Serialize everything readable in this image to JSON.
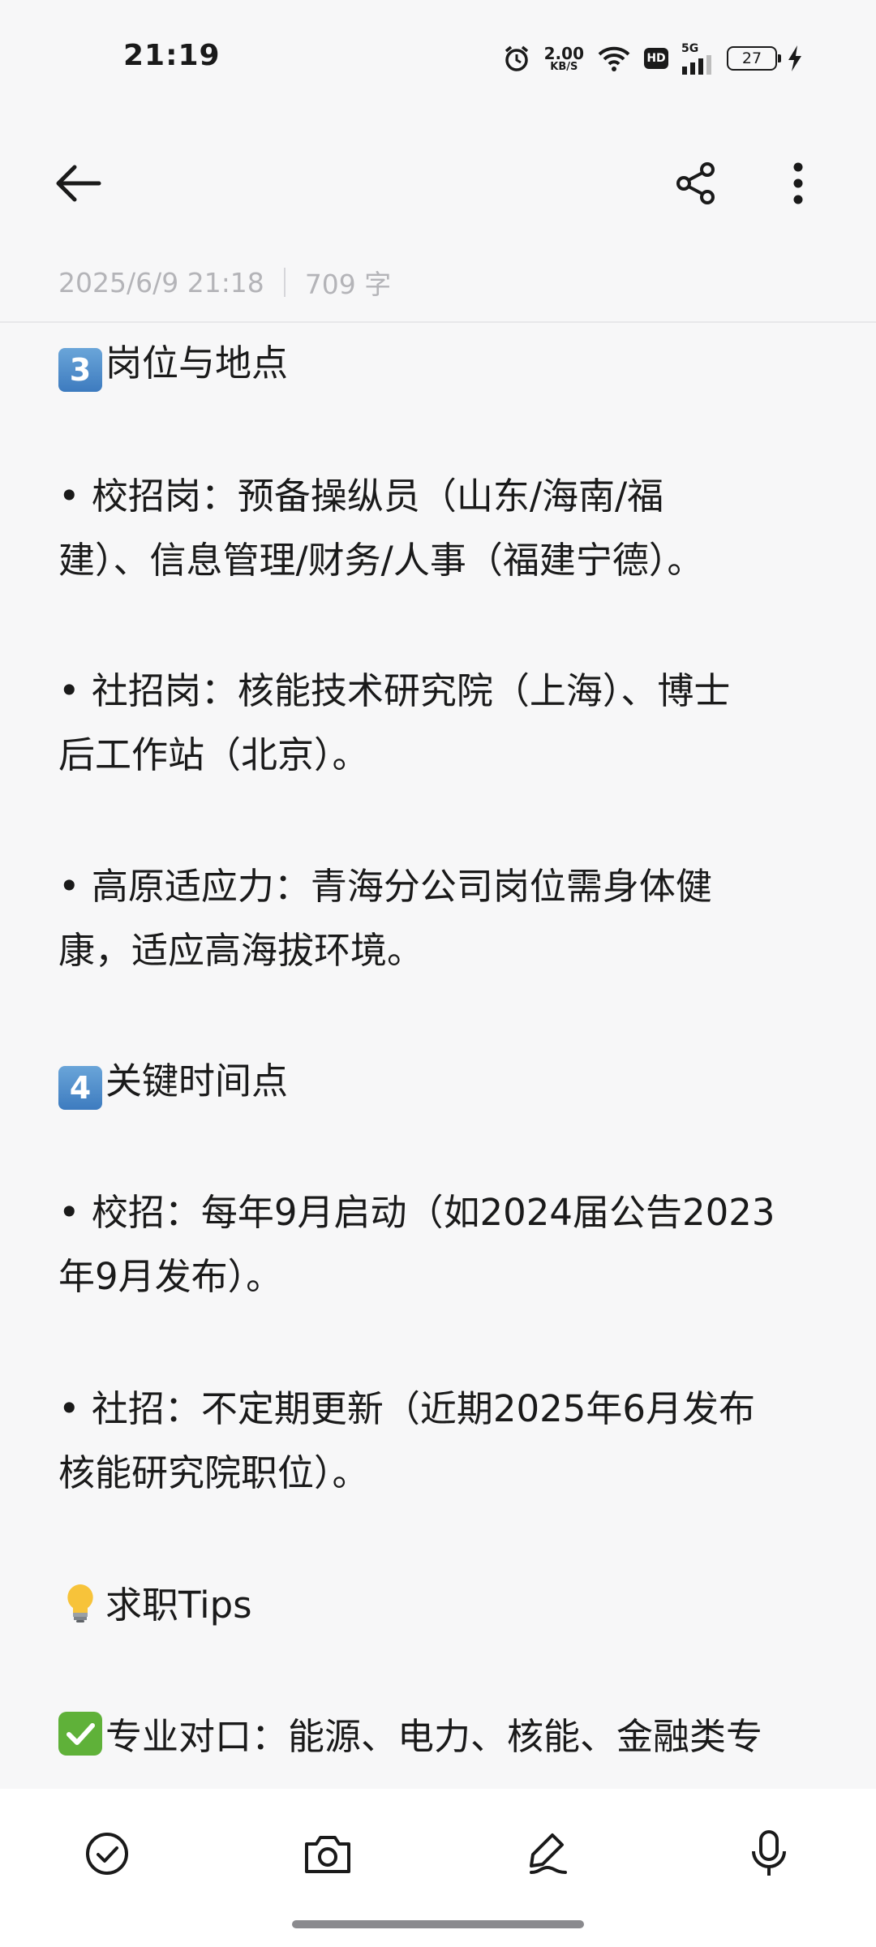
{
  "status_bar": {
    "time": "21:19",
    "net_speed_value": "2.00",
    "net_speed_unit": "KB/S",
    "hd_label": "HD",
    "network_label": "5G",
    "battery_level": "27",
    "icons": [
      "alarm-icon",
      "wifi-icon",
      "signal-icon",
      "battery-icon",
      "charging-icon"
    ]
  },
  "toolbar": {
    "back_icon": "arrow-left-icon",
    "share_icon": "share-icon",
    "more_icon": "more-vertical-icon"
  },
  "meta": {
    "datetime": "2025/6/9 21:18",
    "word_count": "709 字"
  },
  "content": {
    "heading3_badge": "3",
    "heading3_text": "岗位与地点",
    "p1_line1": " • 校招岗：预备操纵员（山东/海南/福",
    "p1_line2": "建）、信息管理/财务/人事（福建宁德）。",
    "p2_line1": " • 社招岗：核能技术研究院（上海）、博士",
    "p2_line2": "后工作站（北京）。",
    "p3_line1": " • 高原适应力：青海分公司岗位需身体健",
    "p3_line2": "康，适应高海拔环境。",
    "heading4_badge": "4",
    "heading4_text": "关键时间点",
    "p4_line1": " • 校招：每年9月启动（如2024届公告2023",
    "p4_line2": "年9月发布）。",
    "p5_line1": " • 社招：不定期更新（近期2025年6月发布",
    "p5_line2": "核能研究院职位）。",
    "tips_heading": "求职Tips",
    "tip1_line1": "专业对口：能源、电力、核能、金融类专"
  },
  "bottom_bar": {
    "icons": [
      "checklist-icon",
      "camera-icon",
      "handwriting-pen-icon",
      "microphone-icon"
    ]
  },
  "colors": {
    "background": "#f7f7f8",
    "text": "#1a1a1a",
    "meta_text": "#b4b4b8",
    "keycap_blue": "#4a8ccb",
    "check_green": "#5fb139"
  }
}
